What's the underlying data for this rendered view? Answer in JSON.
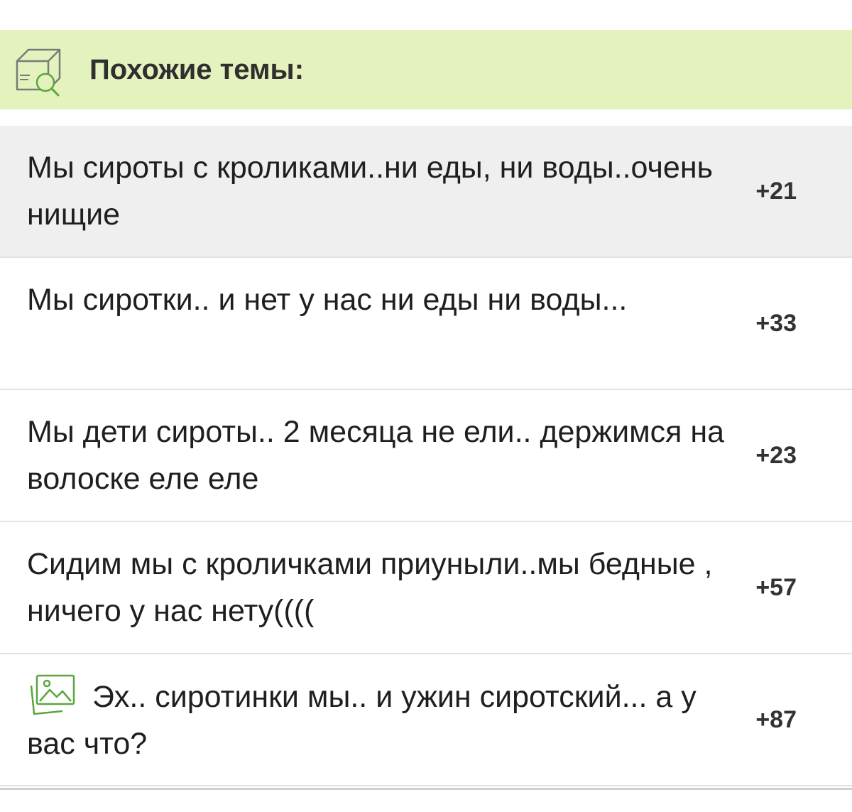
{
  "header": {
    "title": "Похожие темы:",
    "icon": "box-search-icon",
    "background_color": "#e4f2bd",
    "icon_color": "#7a7a7a",
    "lens_color": "#5aa63a"
  },
  "topics": [
    {
      "text": "Мы сироты с кроликами..ни еды, ни воды..очень нищие",
      "score": "+21",
      "highlighted": true
    },
    {
      "text": "Мы сиротки.. и нет у нас ни еды ни воды...",
      "score": "+33",
      "highlighted": false
    },
    {
      "text": "Мы дети сироты.. 2 месяца не ели.. держимся на волоске еле еле",
      "score": "+23",
      "highlighted": false
    },
    {
      "text": "Сидим мы с кроличками приуныли..мы бедные , ничего у нас нету((((",
      "score": "+57",
      "highlighted": false
    },
    {
      "text": "Эх.. сиротинки мы.. и ужин сиротский... а у вас что?",
      "score": "+87",
      "highlighted": false,
      "icon": "image-icon",
      "icon_color": "#5aa63a"
    }
  ]
}
